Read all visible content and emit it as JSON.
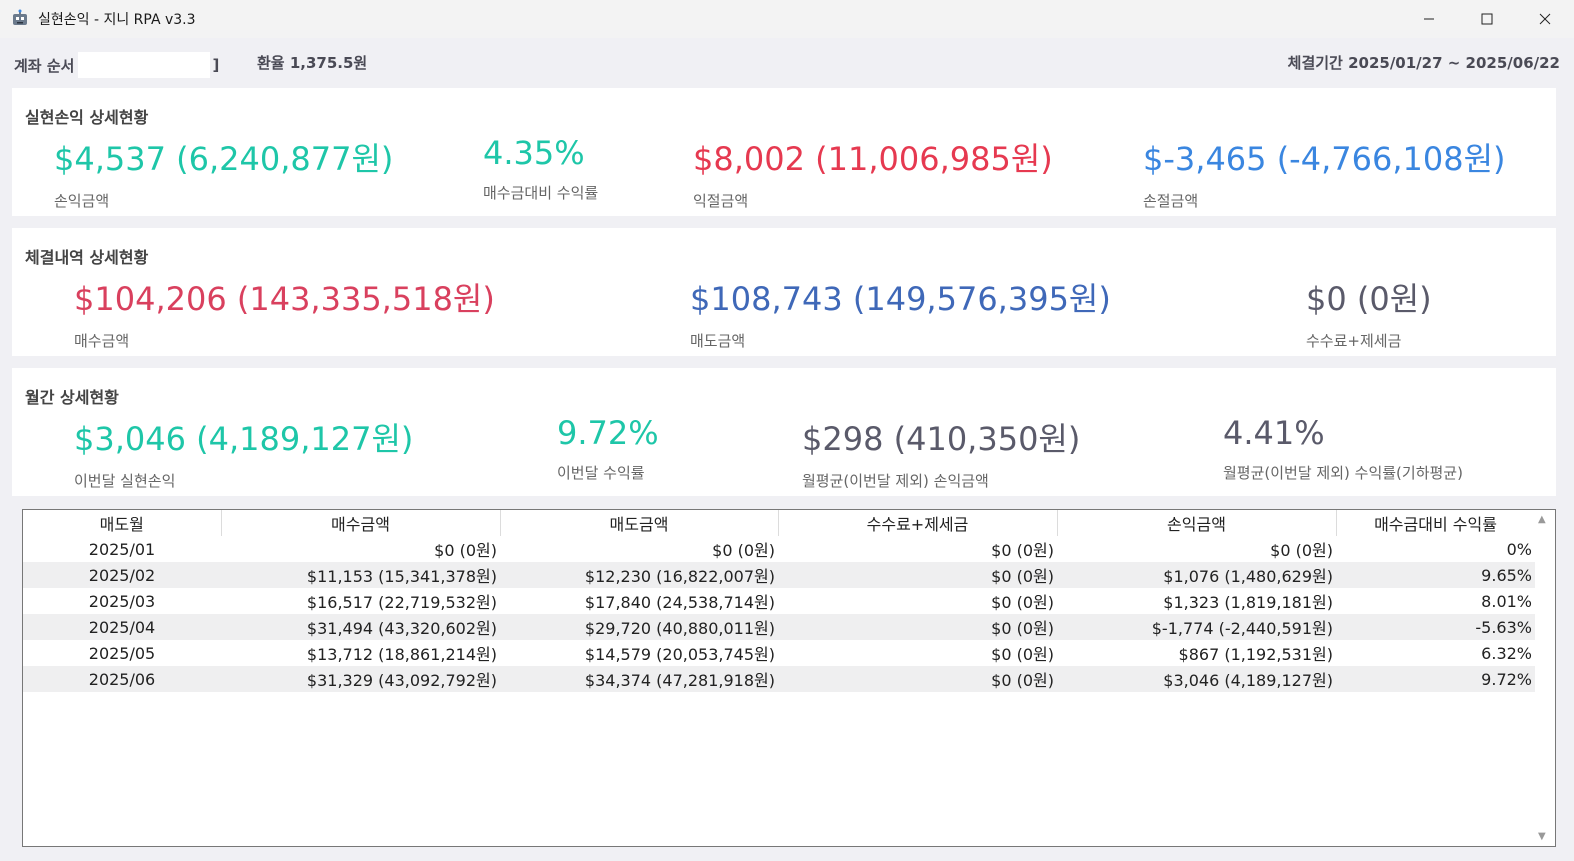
{
  "window": {
    "title": "실현손익 - 지니 RPA v3.3",
    "minimize_icon": "minimize-icon",
    "maximize_icon": "maximize-icon",
    "close_icon": "close-icon"
  },
  "info": {
    "account_label": "계좌 순서",
    "account_suffix": "]",
    "exchange_rate": "환율 1,375.5원",
    "period": "체결기간 2025/01/27 ~ 2025/06/22"
  },
  "colors": {
    "profit": "#1ec6a8",
    "gain": "#e63950",
    "loss": "#3a86e0",
    "buy": "#d9405e",
    "sell": "#3f68b8",
    "neutral": "#5a5a6a"
  },
  "realized": {
    "title": "실현손익 상세현황",
    "profit_amount": "$4,537 (6,240,877원)",
    "profit_amount_label": "손익금액",
    "return_rate": "4.35%",
    "return_rate_label": "매수금대비 수익률",
    "gain_amount": "$8,002 (11,006,985원)",
    "gain_amount_label": "익절금액",
    "loss_amount": "$-3,465 (-4,766,108원)",
    "loss_amount_label": "손절금액"
  },
  "execution": {
    "title": "체결내역 상세현황",
    "buy_amount": "$104,206 (143,335,518원)",
    "buy_amount_label": "매수금액",
    "sell_amount": "$108,743 (149,576,395원)",
    "sell_amount_label": "매도금액",
    "fee_tax": "$0 (0원)",
    "fee_tax_label": "수수료+제세금"
  },
  "monthly": {
    "title": "월간 상세현황",
    "this_month_profit": "$3,046 (4,189,127원)",
    "this_month_profit_label": "이번달 실현손익",
    "this_month_rate": "9.72%",
    "this_month_rate_label": "이번달 수익률",
    "avg_profit": "$298 (410,350원)",
    "avg_profit_label": "월평균(이번달 제외) 손익금액",
    "avg_rate": "4.41%",
    "avg_rate_label": "월평균(이번달 제외) 수익률(기하평균)"
  },
  "table": {
    "headers": [
      "매도월",
      "매수금액",
      "매도금액",
      "수수료+제세금",
      "손익금액",
      "매수금대비 수익률"
    ],
    "rows": [
      [
        "2025/01",
        "$0 (0원)",
        "$0 (0원)",
        "$0 (0원)",
        "$0 (0원)",
        "0%"
      ],
      [
        "2025/02",
        "$11,153 (15,341,378원)",
        "$12,230 (16,822,007원)",
        "$0 (0원)",
        "$1,076 (1,480,629원)",
        "9.65%"
      ],
      [
        "2025/03",
        "$16,517 (22,719,532원)",
        "$17,840 (24,538,714원)",
        "$0 (0원)",
        "$1,323 (1,819,181원)",
        "8.01%"
      ],
      [
        "2025/04",
        "$31,494 (43,320,602원)",
        "$29,720 (40,880,011원)",
        "$0 (0원)",
        "$-1,774 (-2,440,591원)",
        "-5.63%"
      ],
      [
        "2025/05",
        "$13,712 (18,861,214원)",
        "$14,579 (20,053,745원)",
        "$0 (0원)",
        "$867 (1,192,531원)",
        "6.32%"
      ],
      [
        "2025/06",
        "$31,329 (43,092,792원)",
        "$34,374 (47,281,918원)",
        "$0 (0원)",
        "$3,046 (4,189,127원)",
        "9.72%"
      ]
    ]
  }
}
